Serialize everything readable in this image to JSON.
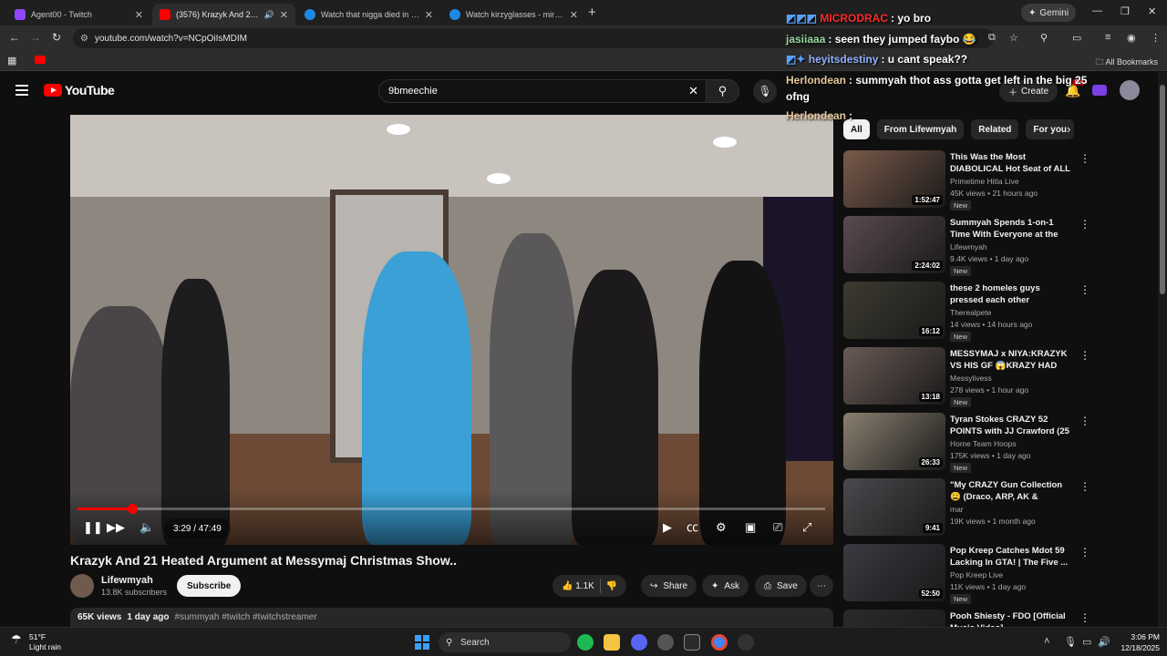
{
  "tabs": [
    {
      "title": "Agent00 - Twitch",
      "color": "#9146ff",
      "active": false
    },
    {
      "title": "(3576) Krazyk And 21 Heated",
      "color": "#ff0000",
      "active": true
    },
    {
      "title": "Watch that nigga died in gallery",
      "color": "#1e88e5",
      "active": false
    },
    {
      "title": "Watch kirzyglasses - mir | Stream",
      "color": "#1e88e5",
      "active": false
    }
  ],
  "browser": {
    "url": "youtube.com/watch?v=NCpOiIsMDIM",
    "gemini_label": "Gemini",
    "all_bookmarks": "All Bookmarks"
  },
  "youtube": {
    "logo_text": "YouTube",
    "search_value": "9bmeechie",
    "create_label": "Create",
    "notif_badge": "9+"
  },
  "video": {
    "time_display": "3:29 / 47:49",
    "progress": 0.073,
    "title": "Krazyk And 21 Heated Argument at Messymaj Christmas Show..",
    "channel": "Lifewmyah",
    "subscribers": "13.8K subscribers",
    "subscribe_label": "Subscribe",
    "likes": "1.1K",
    "share_label": "Share",
    "ask_label": "Ask",
    "save_label": "Save",
    "views": "65K views",
    "age": "1 day ago",
    "hashtags": "#summyah #twitch #twitchstreamer"
  },
  "chips": [
    "All",
    "From Lifewmyah",
    "Related",
    "For you"
  ],
  "recommendations": [
    {
      "title": "This Was the Most DIABOLICAL Hot Seat of ALL TIME",
      "channel": "Primetime Hitla Live",
      "meta": "45K views • 21 hours ago",
      "badge": "New",
      "duration": "1:52:47",
      "color": "#7a5a4a"
    },
    {
      "title": "Summyah Spends 1-on-1 Time With Everyone at the Messym...",
      "channel": "Lifewmyah",
      "meta": "9.4K views • 1 day ago",
      "badge": "New",
      "duration": "2:24:02",
      "color": "#5a4a52"
    },
    {
      "title": "these 2 homeles guys pressed each other",
      "channel": "Therealpete",
      "meta": "14 views • 14 hours ago",
      "badge": "New",
      "duration": "16:12",
      "color": "#3c3a30"
    },
    {
      "title": "MESSYMAJ x NIYA:KRAZYK VS HIS GF 😱KRAZY HAD SOME ...",
      "channel": "Messylivess",
      "meta": "278 views • 1 hour ago",
      "badge": "New",
      "duration": "13:18",
      "color": "#6a5a55"
    },
    {
      "title": "Tyran Stokes CRAZY 52 POINTS with JJ Crawford (25 Points) ...",
      "channel": "Home Team Hoops",
      "meta": "175K views • 1 day ago",
      "badge": "New",
      "duration": "26:33",
      "color": "#8a8070"
    },
    {
      "title": "\"My CRAZY Gun Collection 😩 (Draco, ARP, AK & More!)\"",
      "channel": "mar",
      "meta": "19K views • 1 month ago",
      "badge": "",
      "duration": "9:41",
      "color": "#4a4a4e"
    },
    {
      "title": "Pop Kreep Catches Mdot 59 Lacking In GTA! | The Five ...",
      "channel": "Pop Kreep Live",
      "meta": "11K views • 1 day ago",
      "badge": "New",
      "duration": "52:50",
      "color": "#3a3a42"
    },
    {
      "title": "Pooh Shiesty - FDO [Official Music Video]",
      "channel": "",
      "meta": "",
      "badge": "",
      "duration": "",
      "color": "#2a2a2a"
    }
  ],
  "chat": [
    {
      "user": "MICRODRAC",
      "msg": ": yo bro",
      "color": "#ff2a2a"
    },
    {
      "user": "jasiiaaa",
      "msg": ": seen they jumped faybo 😂",
      "color": "#9ad7a0"
    },
    {
      "user": "heyitsdestiny",
      "msg": ": u cant speak??",
      "color": "#8fb2ff"
    },
    {
      "user": "Herlondean",
      "msg": ": summyah thot ass gotta get left in the big 25",
      "color": "#e6c79c"
    },
    {
      "user": "",
      "msg": "ofng",
      "color": "#ffffff"
    },
    {
      "user": "Herlondean",
      "msg": ":",
      "color": "#e6c79c"
    }
  ],
  "taskbar": {
    "temp": "51°F",
    "weather": "Light rain",
    "search_label": "Search",
    "time": "3:06 PM",
    "date": "12/18/2025"
  }
}
